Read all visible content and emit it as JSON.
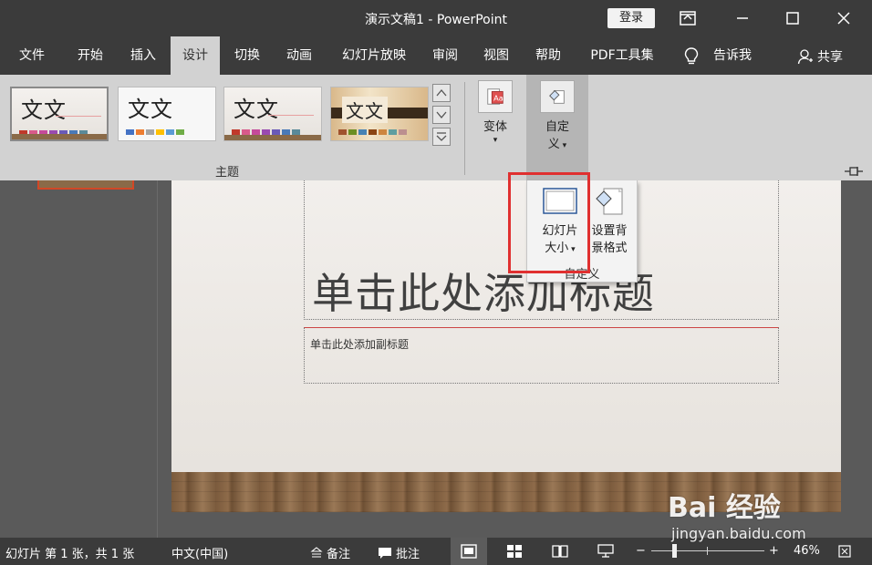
{
  "window": {
    "title": "演示文稿1  -  PowerPoint",
    "login_label": "登录",
    "controls": [
      "restore-ribbon-icon",
      "minimize-icon",
      "maximize-icon",
      "close-icon"
    ]
  },
  "menu": {
    "tabs": [
      {
        "label": "文件"
      },
      {
        "label": "开始"
      },
      {
        "label": "插入"
      },
      {
        "label": "设计",
        "active": true
      },
      {
        "label": "切换"
      },
      {
        "label": "动画"
      },
      {
        "label": "幻灯片放映"
      },
      {
        "label": "审阅"
      },
      {
        "label": "视图"
      },
      {
        "label": "帮助"
      },
      {
        "label": "PDF工具集"
      }
    ],
    "tell_me": "告诉我",
    "share": "共享"
  },
  "ribbon": {
    "themes_group_label": "主题",
    "theme_sample_text": "文文",
    "variants_label": "变体",
    "customize_label_line1": "自定",
    "customize_label_line2": "义",
    "customize_dropdown": {
      "slide_size_line1": "幻灯片",
      "slide_size_line2": "大小",
      "format_bg_line1": "设置背",
      "format_bg_line2": "景格式",
      "group_label": "自定义"
    }
  },
  "slide": {
    "title_placeholder": "单击此处添加标题",
    "subtitle_placeholder": "单击此处添加副标题"
  },
  "status": {
    "slide_info": "幻灯片 第 1 张，共 1 张",
    "language": "中文(中国)",
    "notes": "备注",
    "comments": "批注",
    "zoom": "46%"
  },
  "watermark": {
    "brand": "Bai 经验",
    "url": "jingyan.baidu.com"
  },
  "colors": {
    "chrome_dark": "#3b3b3b",
    "ribbon_bg": "#d2d2d2",
    "highlight_red": "#e03030"
  }
}
